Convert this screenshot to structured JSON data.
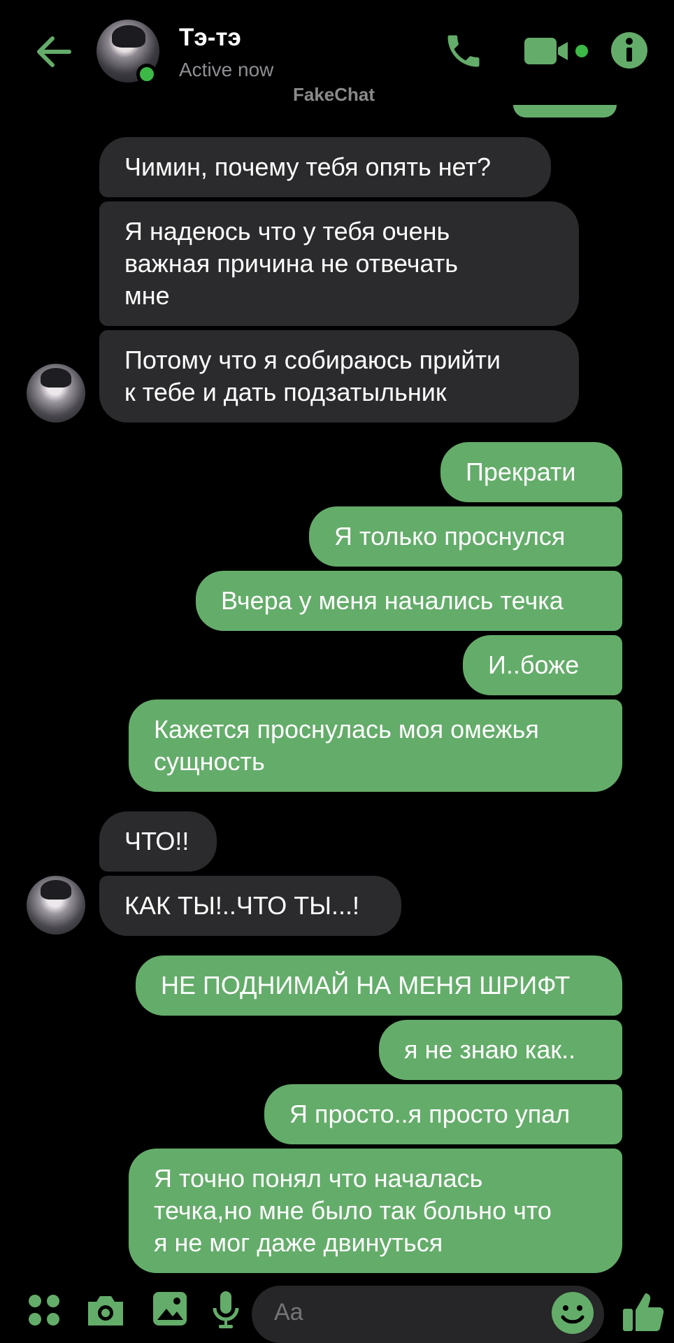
{
  "header": {
    "contact_name": "Тэ-тэ",
    "status": "Active now",
    "watermark": "FakeChat"
  },
  "colors": {
    "accent": "#64ac6a",
    "incoming_bubble": "#2b2b2d",
    "background": "#000000",
    "online": "#3cb846"
  },
  "messages": [
    {
      "from": "contact",
      "text": "Чимин, почему тебя опять нет?"
    },
    {
      "from": "contact",
      "lines": [
        "Я надеюсь что у тебя очень",
        "важная причина не отвечать",
        "мне"
      ]
    },
    {
      "from": "contact",
      "lines": [
        "Потому что я собираюсь прийти",
        "к тебе и дать подзатыльник"
      ]
    },
    {
      "from": "me",
      "text": "Прекрати"
    },
    {
      "from": "me",
      "text": "Я только проснулся"
    },
    {
      "from": "me",
      "text": "Вчера у меня начались течка"
    },
    {
      "from": "me",
      "text": "И..боже"
    },
    {
      "from": "me",
      "lines": [
        "Кажется проснулась моя омежья",
        "сущность"
      ]
    },
    {
      "from": "contact",
      "text": "ЧТО!!"
    },
    {
      "from": "contact",
      "text": "КАК ТЫ!..ЧТО ТЫ...!"
    },
    {
      "from": "me",
      "text": "НЕ ПОДНИМАЙ НА МЕНЯ ШРИФТ"
    },
    {
      "from": "me",
      "text": "я не знаю как.."
    },
    {
      "from": "me",
      "text": "Я просто..я просто упал"
    },
    {
      "from": "me",
      "lines": [
        "Я точно понял что началась",
        "течка,но мне было так больно что",
        "я не мог даже двинуться"
      ]
    }
  ],
  "composer": {
    "placeholder": "Aa",
    "icons": [
      "apps-icon",
      "camera-icon",
      "gallery-icon",
      "microphone-icon",
      "emoji-icon",
      "thumbs-up-icon"
    ]
  }
}
